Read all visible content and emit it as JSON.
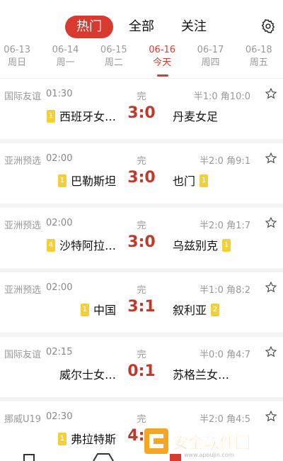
{
  "tabs": [
    {
      "label": "热门",
      "active": true
    },
    {
      "label": "全部",
      "active": false
    },
    {
      "label": "关注",
      "active": false
    }
  ],
  "dates": [
    {
      "date": "06-13",
      "weekday": "周日",
      "active": false
    },
    {
      "date": "06-14",
      "weekday": "周一",
      "active": false
    },
    {
      "date": "06-15",
      "weekday": "周二",
      "active": false
    },
    {
      "date": "06-16",
      "weekday": "今天",
      "active": true
    },
    {
      "date": "06-17",
      "weekday": "周四",
      "active": false
    },
    {
      "date": "06-18",
      "weekday": "周五",
      "active": false
    }
  ],
  "matches": [
    {
      "league": "国际友谊",
      "time": "01:30",
      "status": "完",
      "half": "半1:0  角10:0",
      "home_badge": "1",
      "home": "西班牙女…",
      "score": "3:0",
      "away": "丹麦女足",
      "away_badge": ""
    },
    {
      "league": "亚洲预选",
      "time": "02:00",
      "status": "完",
      "half": "半2:0  角9:1",
      "home_badge": "1",
      "home": "巴勒斯坦",
      "score": "3:0",
      "away": "也门",
      "away_badge": "1"
    },
    {
      "league": "亚洲预选",
      "time": "02:00",
      "status": "完",
      "half": "半2:0  角1:7",
      "home_badge": "4",
      "home": "沙特阿拉…",
      "score": "3:0",
      "away": "乌兹别克",
      "away_badge": "1"
    },
    {
      "league": "亚洲预选",
      "time": "02:00",
      "status": "完",
      "half": "半1:0  角8:2",
      "home_badge": "1",
      "home": "中国",
      "score": "3:1",
      "away": "叙利亚",
      "away_badge": "2"
    },
    {
      "league": "国际友谊",
      "time": "02:15",
      "status": "完",
      "half": "半0:0  角4:7",
      "home_badge": "",
      "home": "威尔士女…",
      "score": "0:1",
      "away": "苏格兰女…",
      "away_badge": ""
    },
    {
      "league": "挪威U19",
      "time": "02:30",
      "status": "完",
      "half": "半2:0  角4:5",
      "home_badge": "1",
      "home": "弗拉特斯",
      "score": "4:1",
      "away": "",
      "away_badge": ""
    }
  ],
  "watermark": {
    "text": "安金软件园",
    "url": "www.apoujin.com"
  },
  "colors": {
    "accent": "#d93a30",
    "score": "#c0392b",
    "badge": "#f2d03b"
  }
}
